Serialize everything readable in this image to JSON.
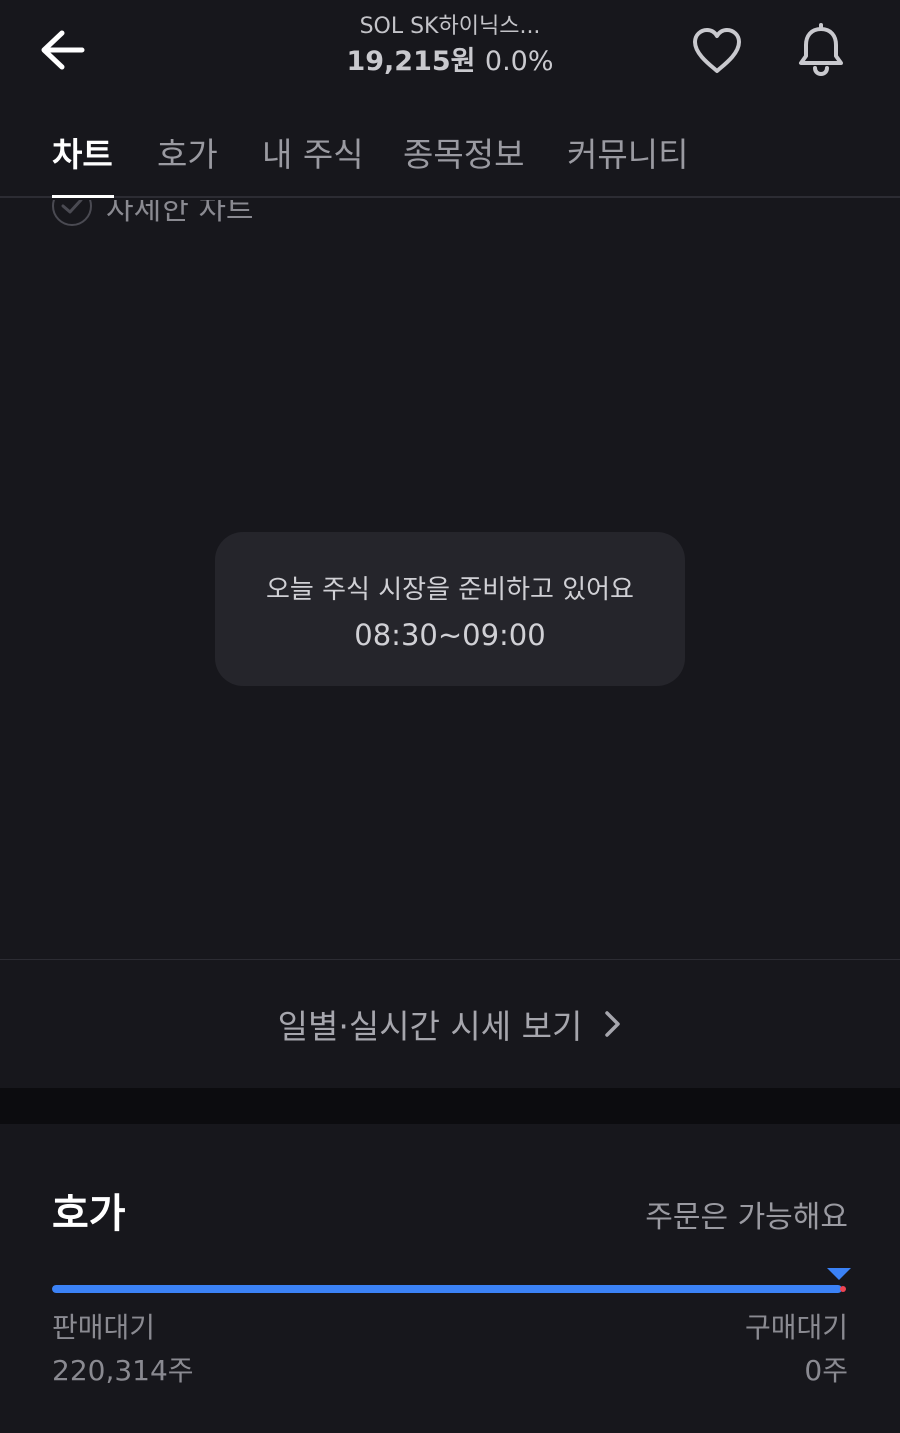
{
  "header": {
    "stock_name": "SOL SK하이닉스...",
    "price": "19,215원",
    "change_rate": "0.0%",
    "back_icon": "arrow-left-icon",
    "favorite_icon": "heart-icon",
    "alert_icon": "bell-icon"
  },
  "tabs": [
    {
      "label": "차트",
      "active": true
    },
    {
      "label": "호가",
      "active": false
    },
    {
      "label": "내 주식",
      "active": false
    },
    {
      "label": "종목정보",
      "active": false
    },
    {
      "label": "커뮤니티",
      "active": false
    }
  ],
  "chart": {
    "detail_toggle_label": "자세한 차트",
    "notice_line1": "오늘 주식 시장을 준비하고 있어요",
    "notice_line2": "08:30~09:00"
  },
  "history_link": {
    "label": "일별·실시간 시세 보기"
  },
  "orderbook": {
    "title": "호가",
    "status": "주문은 가능해요",
    "sell_label": "판매대기",
    "sell_value": "220,314주",
    "buy_label": "구매대기",
    "buy_value": "0주",
    "sell_ratio": 1.0
  },
  "colors": {
    "background": "#17171c",
    "accent_blue": "#3b82f6",
    "accent_red": "#ef4452"
  }
}
